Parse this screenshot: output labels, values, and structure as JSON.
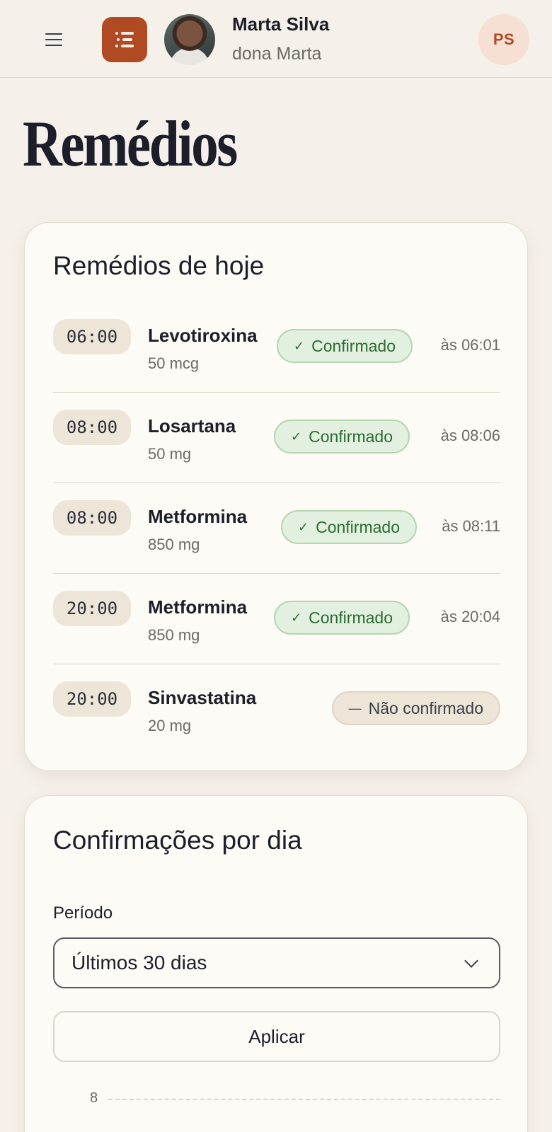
{
  "header": {
    "menu_icon": "hamburger-menu-icon",
    "logo_icon": "list-icon",
    "profile": {
      "name": "Marta Silva",
      "nickname": "dona Marta"
    },
    "user_initials": "PS"
  },
  "page": {
    "title": "Remédios"
  },
  "today": {
    "title": "Remédios de hoje",
    "items": [
      {
        "time": "06:00",
        "name": "Levotiroxina",
        "dose": "50 mcg",
        "status": "Confirmado",
        "confirmed_at": "às 06:01"
      },
      {
        "time": "08:00",
        "name": "Losartana",
        "dose": "50 mg",
        "status": "Confirmado",
        "confirmed_at": "às 08:06"
      },
      {
        "time": "08:00",
        "name": "Metformina",
        "dose": "850 mg",
        "status": "Confirmado",
        "confirmed_at": "às 08:11"
      },
      {
        "time": "20:00",
        "name": "Metformina",
        "dose": "850 mg",
        "status": "Confirmado",
        "confirmed_at": "às 20:04"
      },
      {
        "time": "20:00",
        "name": "Sinvastatina",
        "dose": "20 mg",
        "status": "Não confirmado",
        "confirmed_at": ""
      }
    ]
  },
  "chart_card": {
    "title": "Confirmações por dia",
    "period_label": "Período",
    "period_value": "Últimos 30 dias",
    "apply_label": "Aplicar"
  },
  "chart_data": {
    "type": "bar",
    "title": "",
    "xlabel": "",
    "ylabel": "",
    "y_ticks_visible": [
      "8"
    ]
  },
  "colors": {
    "accent": "#b04a22",
    "confirmed_bg": "#e1f0df",
    "confirmed_text": "#2d6a34",
    "pending_bg": "#ece5d8",
    "background": "#f5f0e9"
  }
}
